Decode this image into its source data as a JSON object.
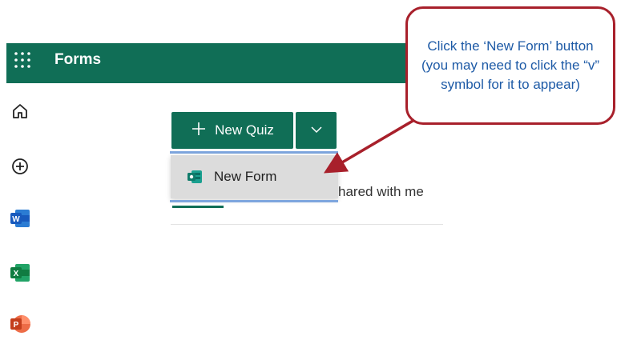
{
  "app": {
    "title": "Forms"
  },
  "toolbar": {
    "new_quiz_label": "New Quiz",
    "plus_icon": "plus-icon",
    "caret_icon": "chevron-down-icon"
  },
  "dropdown": {
    "items": [
      {
        "label": "New Form",
        "icon": "forms-icon"
      }
    ]
  },
  "tabs": {
    "partial_label": "hared with me"
  },
  "leftrail": {
    "items": [
      {
        "icon": "home-icon"
      },
      {
        "icon": "add-circle-icon"
      },
      {
        "icon": "word-icon",
        "letter": "W",
        "color": "#185abd"
      },
      {
        "icon": "excel-icon",
        "letter": "X",
        "color": "#107c41"
      },
      {
        "icon": "powerpoint-icon",
        "letter": "P",
        "color": "#c43e1c"
      }
    ]
  },
  "annotation": {
    "text": "Click the ‘New Form’ button (you may need to click the “v” symbol for it to appear)",
    "border_color": "#a8202b",
    "text_color": "#1d5aa6"
  },
  "colors": {
    "brand": "#106e56",
    "selection": "#7ea6de"
  }
}
